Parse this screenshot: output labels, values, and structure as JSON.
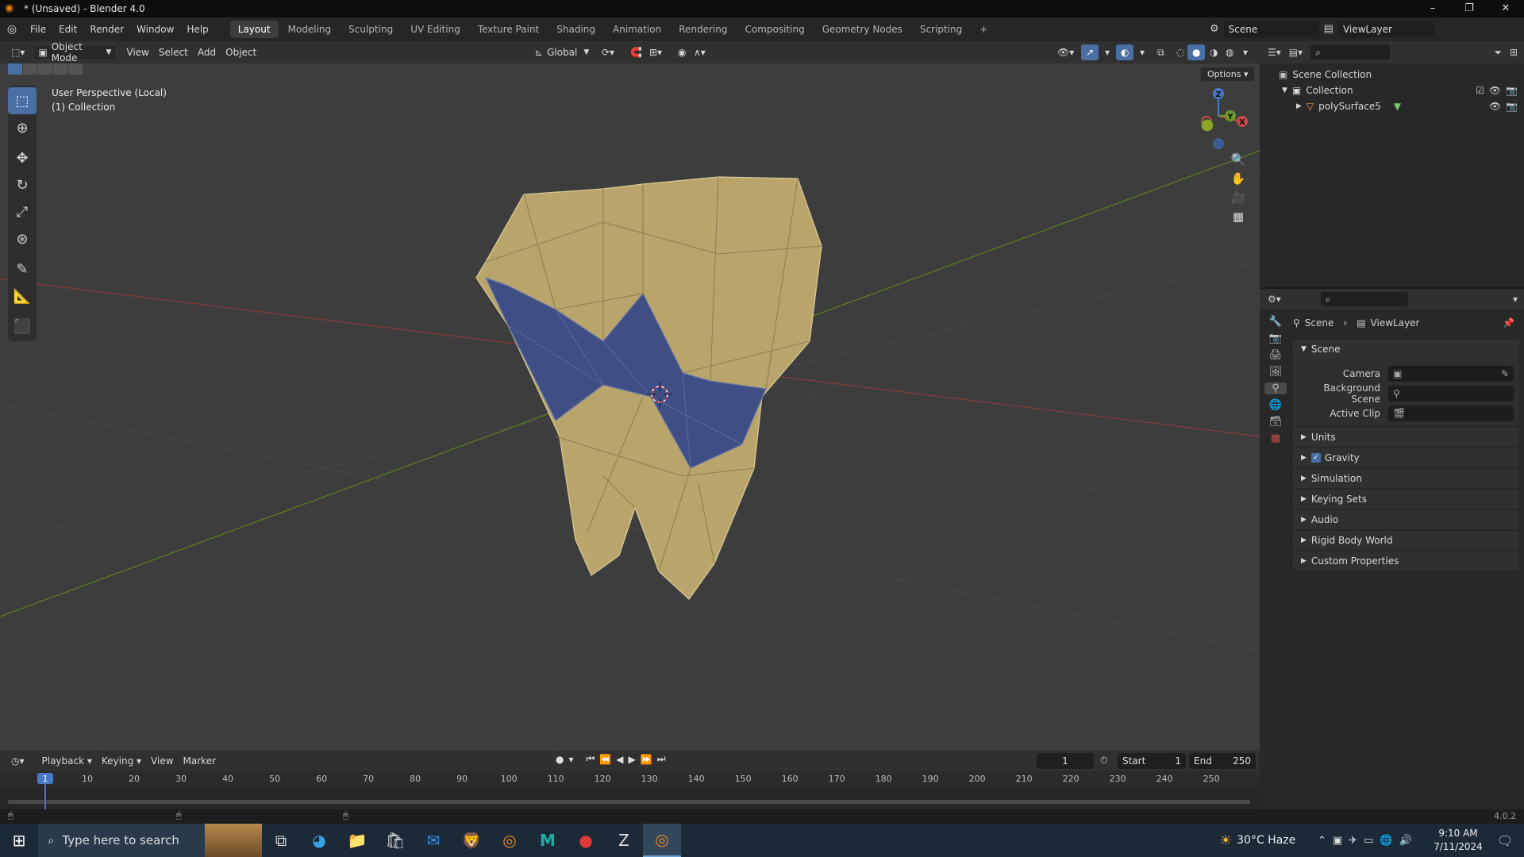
{
  "window": {
    "title": "* (Unsaved) - Blender 4.0",
    "controls": [
      "–",
      "❐",
      "✕"
    ]
  },
  "menu": [
    "File",
    "Edit",
    "Render",
    "Window",
    "Help"
  ],
  "workspaces": [
    "Layout",
    "Modeling",
    "Sculpting",
    "UV Editing",
    "Texture Paint",
    "Shading",
    "Animation",
    "Rendering",
    "Compositing",
    "Geometry Nodes",
    "Scripting",
    "+"
  ],
  "active_workspace": "Layout",
  "scene_selector": {
    "label": "Scene"
  },
  "viewlayer_selector": {
    "label": "ViewLayer"
  },
  "viewport_header": {
    "mode": "Object Mode",
    "menus": [
      "View",
      "Select",
      "Add",
      "Object"
    ],
    "transform_orientation": "Global",
    "options_label": "Options"
  },
  "viewport": {
    "info_line1": "User Perspective (Local)",
    "info_line2": "(1) Collection",
    "gizmo_axes": {
      "x": "X",
      "y": "Y",
      "z": "Z"
    }
  },
  "tools": [
    "select-box",
    "cursor",
    "move",
    "rotate",
    "scale",
    "transform",
    "annotate",
    "measure",
    "add-cube"
  ],
  "outliner": {
    "root": "Scene Collection",
    "collection": "Collection",
    "object": "polySurface5"
  },
  "properties": {
    "breadcrumb": [
      "Scene",
      "ViewLayer"
    ],
    "section": "Scene",
    "fields": [
      {
        "label": "Camera",
        "value": ""
      },
      {
        "label": "Background Scene",
        "value": ""
      },
      {
        "label": "Active Clip",
        "value": ""
      }
    ],
    "panels": [
      "Units",
      "Gravity",
      "Simulation",
      "Keying Sets",
      "Audio",
      "Rigid Body World",
      "Custom Properties"
    ],
    "gravity_checked": true
  },
  "timeline": {
    "menus": [
      "Playback",
      "Keying",
      "View",
      "Marker"
    ],
    "current_frame": "1",
    "start_label": "Start",
    "start": "1",
    "end_label": "End",
    "end": "250",
    "ruler": [
      "1",
      "10",
      "20",
      "30",
      "40",
      "50",
      "60",
      "70",
      "80",
      "90",
      "100",
      "110",
      "120",
      "130",
      "140",
      "150",
      "160",
      "170",
      "180",
      "190",
      "200",
      "210",
      "220",
      "230",
      "240",
      "250"
    ]
  },
  "status": {
    "version": "4.0.2"
  },
  "taskbar": {
    "search_placeholder": "Type here to search",
    "weather": "30°C  Haze",
    "time": "9:10 AM",
    "date": "7/11/2024"
  },
  "colors": {
    "accent": "#4a6fa5",
    "mesh": "#b9a56b",
    "mesh_selected": "#3f4f85",
    "viewport_bg": "#3d3d3d"
  }
}
